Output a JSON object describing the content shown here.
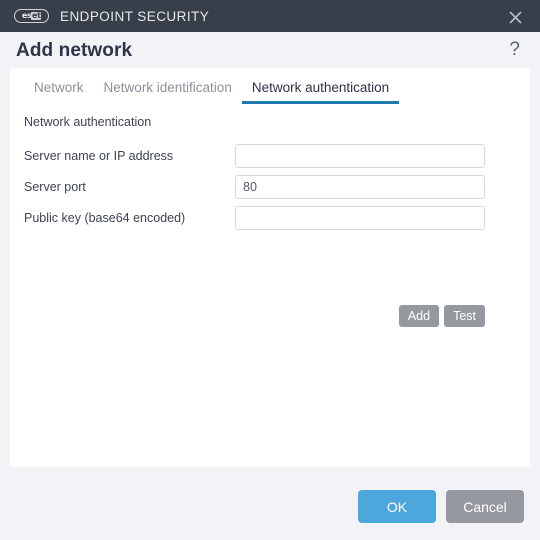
{
  "window": {
    "brand_logo_left": "es",
    "brand_logo_right": "et",
    "brand_title": "ENDPOINT SECURITY",
    "close_icon": "close-icon",
    "titlebar_color": "#393f4a"
  },
  "dialog": {
    "title": "Add network",
    "help_icon": "?",
    "background_color": "#f2f3f6",
    "panel_color": "#ffffff"
  },
  "tabs": [
    {
      "label": "Network",
      "active": false
    },
    {
      "label": "Network identification",
      "active": false
    },
    {
      "label": "Network authentication",
      "active": true
    }
  ],
  "tab_accent_color": "#1f7ab0",
  "form": {
    "section_label": "Network authentication",
    "rows": [
      {
        "label": "Server name or IP address",
        "value": "",
        "placeholder": ""
      },
      {
        "label": "Server port",
        "value": "80",
        "placeholder": ""
      },
      {
        "label": "Public key (base64 encoded)",
        "value": "",
        "placeholder": ""
      }
    ],
    "actions": [
      {
        "label": "Add"
      },
      {
        "label": "Test"
      }
    ]
  },
  "footer": {
    "ok_label": "OK",
    "cancel_label": "Cancel",
    "ok_color": "#4ca7dc",
    "cancel_color": "#95999f"
  }
}
